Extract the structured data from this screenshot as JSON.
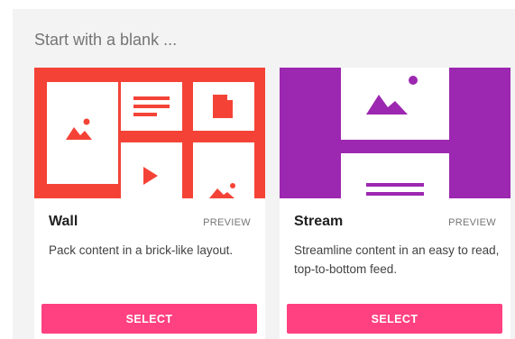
{
  "heading": "Start with a blank ...",
  "colors": {
    "panel": "#f3f3f3",
    "wall_accent": "#f44336",
    "stream_accent": "#9c27b0",
    "button": "#ff4081"
  },
  "cards": [
    {
      "id": "wall",
      "title": "Wall",
      "preview_label": "PREVIEW",
      "description": "Pack content in a brick-like layout.",
      "select_label": "SELECT",
      "illustration_icons": [
        "image-icon",
        "text-lines-icon",
        "document-icon",
        "play-icon",
        "image-icon"
      ]
    },
    {
      "id": "stream",
      "title": "Stream",
      "preview_label": "PREVIEW",
      "description": "Streamline content in an easy to read, top-to-bottom feed.",
      "select_label": "SELECT",
      "illustration_icons": [
        "image-icon",
        "text-lines-icon"
      ]
    }
  ]
}
